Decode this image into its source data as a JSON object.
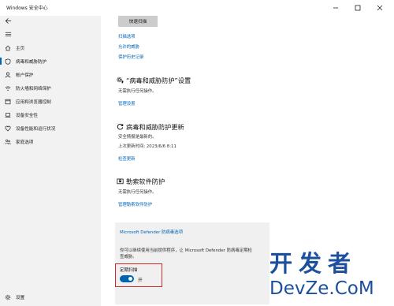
{
  "window": {
    "title": "Windows 安全中心"
  },
  "sidebar": {
    "items": [
      {
        "label": "主页",
        "icon": "home-icon"
      },
      {
        "label": "病毒和威胁防护",
        "icon": "shield-icon"
      },
      {
        "label": "帐户保护",
        "icon": "person-icon"
      },
      {
        "label": "防火墙和网络保护",
        "icon": "wifi-icon"
      },
      {
        "label": "应用和浏览器控制",
        "icon": "app-window-icon"
      },
      {
        "label": "设备安全性",
        "icon": "laptop-icon"
      },
      {
        "label": "设备性能和运行状况",
        "icon": "heart-icon"
      },
      {
        "label": "家庭选项",
        "icon": "family-icon"
      }
    ],
    "settings_label": "设置"
  },
  "main": {
    "quick_scan_label": "快速扫描",
    "links": {
      "scan_options": "扫描选项",
      "allowed_threats": "允许的威胁",
      "protection_history": "保护历史记录"
    },
    "settings_section": {
      "title": "“病毒和威胁防护”设置",
      "subtitle": "无需执行任何操作。",
      "link": "管理设置"
    },
    "updates_section": {
      "title": "病毒和威胁防护更新",
      "subtitle": "安全情报是最新的。",
      "last_update": "上次更新时间: 2023/6/6 8:11",
      "link": "检查更新"
    },
    "ransomware_section": {
      "title": "勒索软件防护",
      "subtitle": "无需执行任何操作。",
      "link": "管理勒索软件防护"
    },
    "defender_panel": {
      "title": "Microsoft Defender 防病毒选项",
      "description": "你可以继续使用当前提供程序，让 Microsoft Defender 防病毒定期检查威胁。",
      "periodic_scan_label": "定期扫描",
      "toggle_state": "开",
      "toggle_on": true
    }
  },
  "watermark": {
    "cn": "开发者",
    "en": "DevZe.CoM"
  },
  "colors": {
    "accent": "#0063b1",
    "highlight": "#d12a2a",
    "sidebar_bg": "#f2f2f2",
    "panel_bg": "#f0f0f0"
  }
}
